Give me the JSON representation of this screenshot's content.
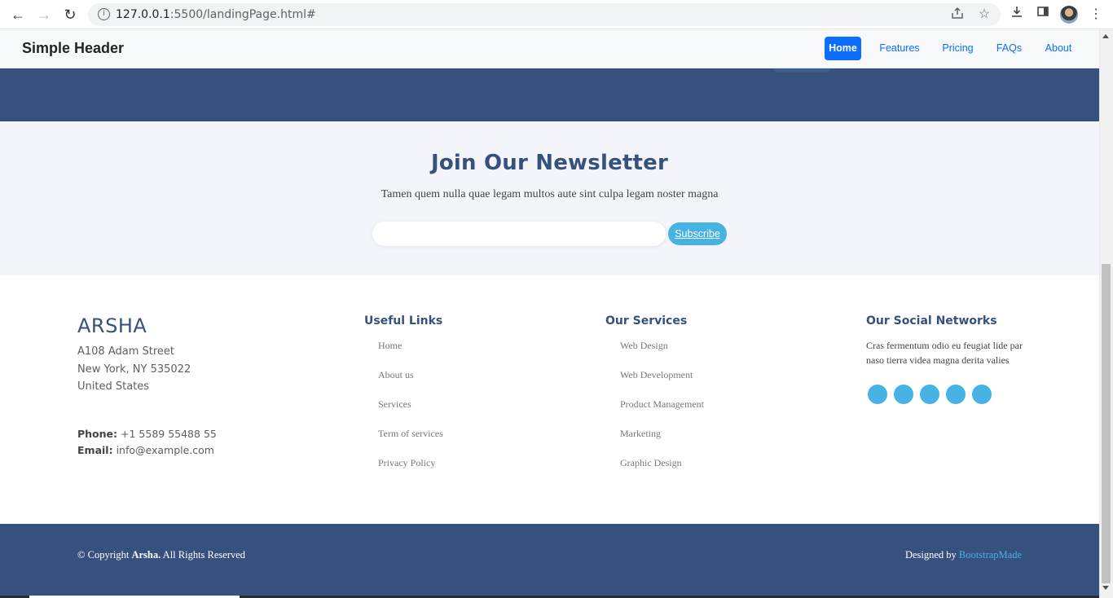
{
  "browser": {
    "back_glyph": "←",
    "forward_glyph": "→",
    "reload_glyph": "↻",
    "url_host": "127.0.0.1",
    "url_rest": ":5500/landingPage.html#",
    "icons": [
      "back-icon",
      "forward-icon",
      "reload-icon",
      "info-icon",
      "share-icon",
      "star-icon",
      "download-icon",
      "side-panel-icon",
      "profile-avatar",
      "menu-icon"
    ]
  },
  "header": {
    "brand": "Simple Header",
    "nav": [
      {
        "label": "Home",
        "active": true
      },
      {
        "label": "Features",
        "active": false
      },
      {
        "label": "Pricing",
        "active": false
      },
      {
        "label": "FAQs",
        "active": false
      },
      {
        "label": "About",
        "active": false
      }
    ]
  },
  "newsletter": {
    "title": "Join Our Newsletter",
    "subtitle": "Tamen quem nulla quae legam multos aute sint culpa legam noster magna",
    "email_value": "",
    "subscribe_label": "Subscribe"
  },
  "footer": {
    "brand": "ARSHA",
    "address": [
      "A108 Adam Street",
      "New York, NY 535022",
      "United States"
    ],
    "phone_label": "Phone:",
    "phone": "+1 5589 55488 55",
    "email_label": "Email:",
    "email": "info@example.com",
    "useful_links": {
      "title": "Useful Links",
      "items": [
        "Home",
        "About us",
        "Services",
        "Term of services",
        "Privacy Policy"
      ]
    },
    "services": {
      "title": "Our Services",
      "items": [
        "Web Design",
        "Web Development",
        "Product Management",
        "Marketing",
        "Graphic Design"
      ]
    },
    "social": {
      "title": "Our Social Networks",
      "text": "Cras fermentum odio eu feugiat lide par naso tierra videa magna derita valies",
      "icons": [
        "twitter-icon",
        "facebook-icon",
        "instagram-icon",
        "skype-icon",
        "linkedin-icon"
      ]
    },
    "copyright_prefix": "© Copyright",
    "copyright_brand": "Arsha.",
    "copyright_suffix": "All Rights Reserved",
    "designed_by": "Designed by",
    "designer": "BootstrapMade"
  },
  "colors": {
    "primary_dark": "#37517e",
    "accent": "#47b2e4",
    "nav_active": "#0d6efd",
    "newsletter_bg": "#f3f5fa"
  }
}
